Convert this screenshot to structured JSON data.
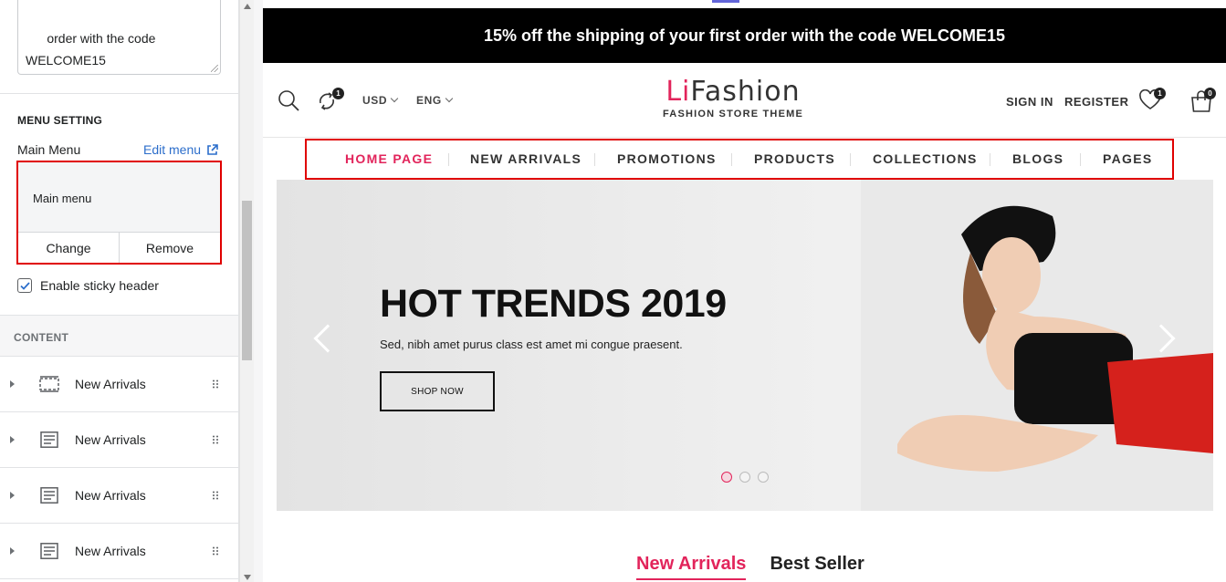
{
  "sidebar": {
    "announcement_text": "order with the code\nWELCOME15",
    "menu_setting": {
      "heading": "MENU SETTING",
      "label": "Main Menu",
      "edit_link": "Edit menu",
      "selected_menu": "Main menu",
      "change_button": "Change",
      "remove_button": "Remove",
      "sticky_label": "Enable sticky header",
      "sticky_checked": true
    },
    "content": {
      "heading": "CONTENT",
      "blocks": [
        {
          "label": "New Arrivals",
          "icon": "section-dashed-icon"
        },
        {
          "label": "New Arrivals",
          "icon": "text-block-icon"
        },
        {
          "label": "New Arrivals",
          "icon": "text-block-icon"
        },
        {
          "label": "New Arrivals",
          "icon": "text-block-icon"
        }
      ]
    }
  },
  "store": {
    "announcement": "15% off the shipping of your first order with the code WELCOME15",
    "header": {
      "compare_count": "1",
      "currency": "USD",
      "language": "ENG",
      "logo_prefix": "Li",
      "logo_suffix": "Fashion",
      "logo_tagline": "FASHION STORE THEME",
      "sign_in": "SIGN IN",
      "register": "REGISTER",
      "wishlist_count": "1",
      "cart_count": "0"
    },
    "nav": {
      "items": [
        "HOME PAGE",
        "NEW ARRIVALS",
        "PROMOTIONS",
        "PRODUCTS",
        "COLLECTIONS",
        "BLOGS",
        "PAGES"
      ],
      "active_index": 0
    },
    "hero": {
      "title": "HOT TRENDS 2019",
      "subtitle": "Sed, nibh amet purus class est amet mi congue praesent.",
      "button": "SHOP NOW",
      "slide_count": 3,
      "active_slide": 0
    },
    "product_tabs": {
      "items": [
        "New Arrivals",
        "Best Seller"
      ],
      "active_index": 0
    }
  },
  "colors": {
    "accent": "#e2245b",
    "highlight": "#e00000",
    "link": "#2c6ecb",
    "announcement_bg": "#000000"
  }
}
